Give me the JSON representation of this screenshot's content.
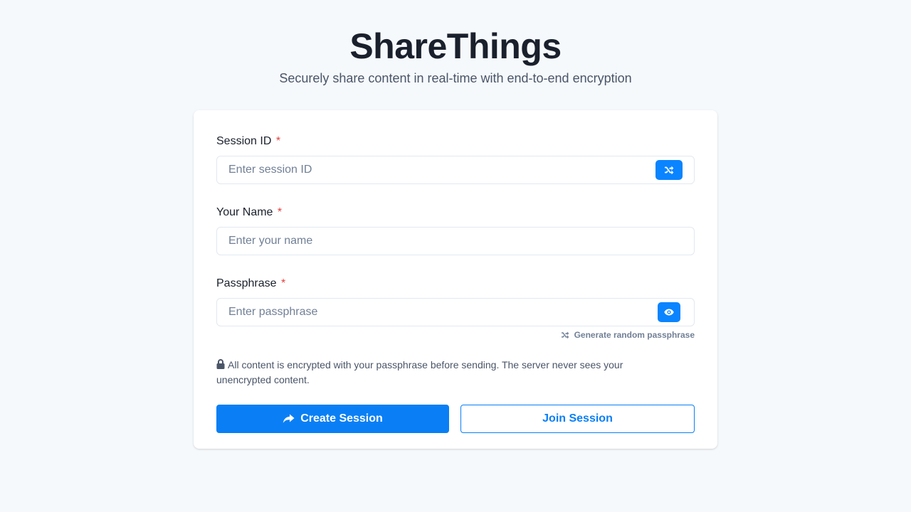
{
  "header": {
    "title": "ShareThings",
    "subtitle": "Securely share content in real-time with end-to-end encryption"
  },
  "form": {
    "session_id": {
      "label": "Session ID",
      "required_mark": "*",
      "placeholder": "Enter session ID",
      "value": "",
      "action_icon": "shuffle-icon"
    },
    "name": {
      "label": "Your Name",
      "required_mark": "*",
      "placeholder": "Enter your name",
      "value": ""
    },
    "passphrase": {
      "label": "Passphrase",
      "required_mark": "*",
      "placeholder": "Enter passphrase",
      "value": "",
      "action_icon": "eye-icon",
      "generate_label": "Generate random passphrase",
      "generate_icon": "shuffle-icon"
    },
    "notice": {
      "icon": "lock-icon",
      "text": "All content is encrypted with your passphrase before sending. The server never sees your unencrypted content."
    },
    "buttons": {
      "create_label": "Create Session",
      "create_icon": "share-arrow-icon",
      "join_label": "Join Session"
    }
  },
  "colors": {
    "background": "#f5f9fc",
    "accent": "#0a7ff5",
    "required": "#e53e3e",
    "text": "#1a202c",
    "muted": "#718096"
  }
}
